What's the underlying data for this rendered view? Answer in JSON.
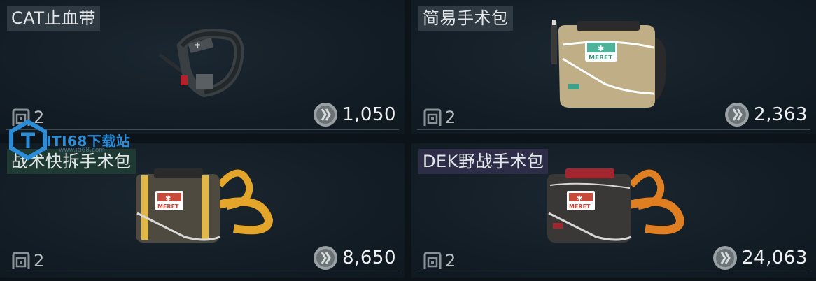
{
  "items": [
    {
      "name": "CAT止血带",
      "slots": "2",
      "price": "1,050"
    },
    {
      "name": "简易手术包",
      "slots": "2",
      "price": "2,363"
    },
    {
      "name": "战术快拆手术包",
      "slots": "2",
      "price": "8,650"
    },
    {
      "name": "DEK野战手术包",
      "slots": "2",
      "price": "24,063"
    }
  ],
  "watermark": {
    "text": "ITI68下载站",
    "sub": "www.iti68.com"
  },
  "colors": {
    "background": "#0c141a",
    "card": "#131d25",
    "title_common": "#2f3a42",
    "title_green": "#1e3a33",
    "title_purple": "#2e2d48"
  }
}
